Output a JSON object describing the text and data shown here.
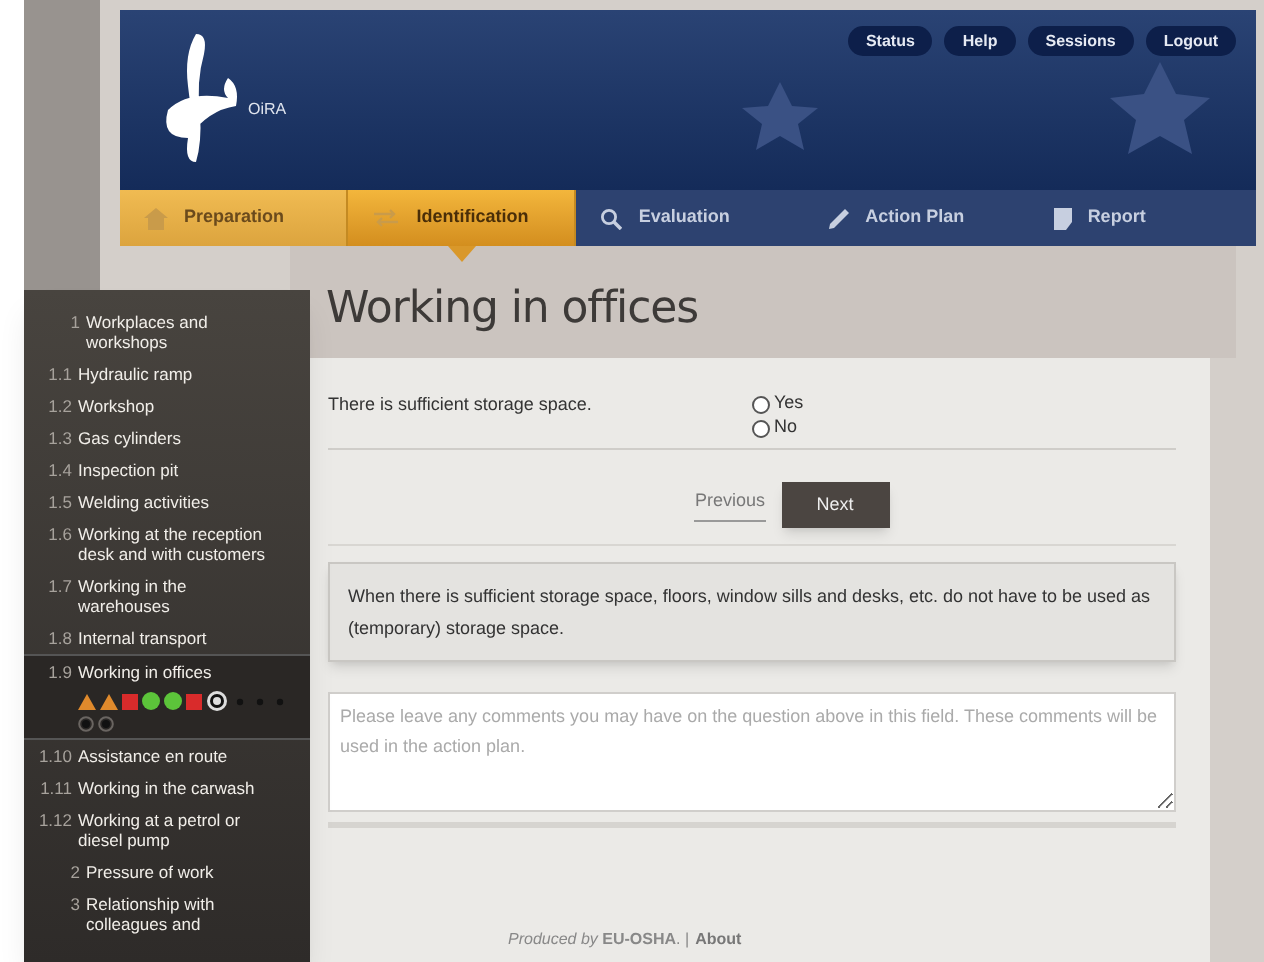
{
  "header": {
    "logo_text": "OiRA",
    "buttons": [
      "Status",
      "Help",
      "Sessions",
      "Logout"
    ]
  },
  "steps": [
    {
      "label": "Preparation",
      "reached": true,
      "selected": false
    },
    {
      "label": "Identification",
      "reached": true,
      "selected": true
    },
    {
      "label": "Evaluation",
      "reached": false,
      "selected": false
    },
    {
      "label": "Action Plan",
      "reached": false,
      "selected": false
    },
    {
      "label": "Report",
      "reached": false,
      "selected": false
    }
  ],
  "sidebar": {
    "items": [
      {
        "number": "1",
        "label": "Workplaces and workshops",
        "selected": false,
        "children": [
          {
            "number": "1.1",
            "label": "Hydraulic ramp",
            "selected": false
          },
          {
            "number": "1.2",
            "label": "Workshop",
            "selected": false
          },
          {
            "number": "1.3",
            "label": "Gas cylinders",
            "selected": false
          },
          {
            "number": "1.4",
            "label": "Inspection pit",
            "selected": false
          },
          {
            "number": "1.5",
            "label": "Welding activities",
            "selected": false
          },
          {
            "number": "1.6",
            "label": "Working at the reception desk and with customers",
            "selected": false
          },
          {
            "number": "1.7",
            "label": "Working in the warehouses",
            "selected": false
          },
          {
            "number": "1.8",
            "label": "Internal transport",
            "selected": false
          },
          {
            "number": "1.9",
            "label": "Working in offices",
            "selected": true,
            "markers": [
              {
                "kind": "triangle",
                "color": "#e08a2c"
              },
              {
                "kind": "triangle",
                "color": "#e08a2c"
              },
              {
                "kind": "square",
                "color": "#d92b2b"
              },
              {
                "kind": "circle",
                "color": "#5cc43a"
              },
              {
                "kind": "circle",
                "color": "#5cc43a"
              },
              {
                "kind": "square",
                "color": "#d92b2b"
              },
              {
                "kind": "ring",
                "color": "#111111"
              },
              {
                "kind": "dot",
                "color": "#111111"
              },
              {
                "kind": "dot",
                "color": "#111111"
              },
              {
                "kind": "dot",
                "color": "#111111"
              },
              {
                "kind": "ringed-dot",
                "color": "#111111"
              },
              {
                "kind": "ringed-dot",
                "color": "#111111"
              }
            ]
          },
          {
            "number": "1.10",
            "label": "Assistance en route",
            "selected": false
          },
          {
            "number": "1.11",
            "label": "Working in the carwash",
            "selected": false
          },
          {
            "number": "1.12",
            "label": "Working at a petrol or diesel pump",
            "selected": false
          }
        ]
      },
      {
        "number": "2",
        "label": "Pressure of work",
        "selected": false
      },
      {
        "number": "3",
        "label": "Relationship with colleagues and",
        "selected": false
      }
    ]
  },
  "page": {
    "title": "Working in offices",
    "question": "There is sufficient storage space.",
    "options": [
      {
        "label": "Yes",
        "selected": false
      },
      {
        "label": "No",
        "selected": false
      }
    ],
    "previous": "Previous",
    "next": "Next",
    "info": "When there is sufficient storage space, floors, window sills and desks, etc. do not have to be used as (temporary) storage space.",
    "comment_placeholder": "Please leave any comments you may have on the question above in this field. These comments will be used in the action plan."
  },
  "footer": {
    "text": "*Produced by* **EU-OSHA**. |",
    "link": "About"
  }
}
